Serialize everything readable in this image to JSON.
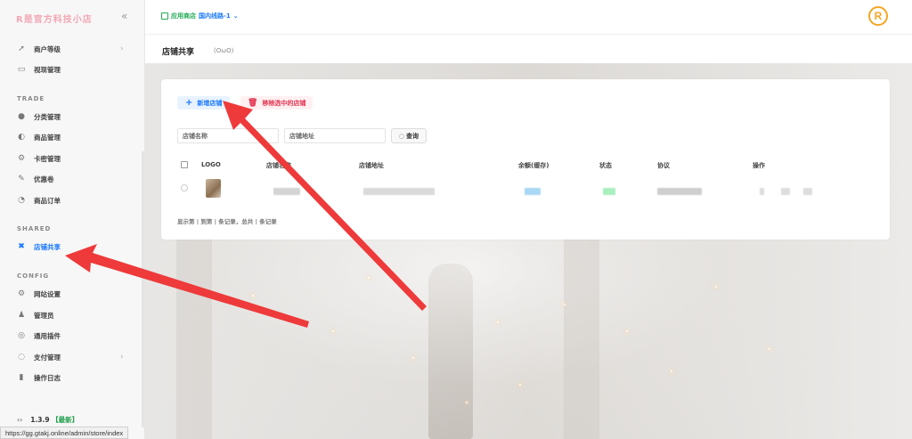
{
  "sidebar": {
    "brand": "R是官方科技小店",
    "items_top": [
      {
        "label": "商户等级",
        "icon": "rocket-icon"
      },
      {
        "label": "视现管理",
        "icon": "list-icon"
      }
    ],
    "sections": [
      {
        "label": "TRADE",
        "items": [
          {
            "label": "分类管理",
            "icon": "folder-icon"
          },
          {
            "label": "商品管理",
            "icon": "box-icon"
          },
          {
            "label": "卡密管理",
            "icon": "key-icon"
          },
          {
            "label": "优惠卷",
            "icon": "ticket-icon"
          },
          {
            "label": "商品订单",
            "icon": "order-icon"
          }
        ]
      },
      {
        "label": "SHARED",
        "items": [
          {
            "label": "店铺共享",
            "icon": "share-icon",
            "active": true
          }
        ]
      },
      {
        "label": "CONFIG",
        "items": [
          {
            "label": "网站设置",
            "icon": "settings-icon"
          },
          {
            "label": "管理员",
            "icon": "admin-icon"
          },
          {
            "label": "通用插件",
            "icon": "plugin-icon"
          },
          {
            "label": "支付管理",
            "icon": "payment-icon"
          },
          {
            "label": "操作日志",
            "icon": "log-icon"
          }
        ]
      }
    ],
    "version": "1.3.9",
    "version_tag": "【最新】"
  },
  "statusbar": {
    "url": "https://gg.gtakj.online/admin/store/index"
  },
  "topbar": {
    "store_label": "应用商店",
    "line_label": "国内线路-1",
    "logo_letter": "R"
  },
  "page": {
    "title": "店铺共享",
    "subtitle": "(OωO)"
  },
  "toolbar": {
    "add_label": "新增店铺",
    "delete_label": "移除选中的店铺"
  },
  "search": {
    "name_placeholder": "店铺名称",
    "address_placeholder": "店铺地址",
    "button_label": "查询"
  },
  "table": {
    "columns": [
      "LOGO",
      "店铺名称",
      "店铺地址",
      "余额(缓存)",
      "状态",
      "协议",
      "操作"
    ]
  },
  "pagination": {
    "text": "显示第 | 到第 | 条记录，总共 | 条记录"
  },
  "colors": {
    "primary": "#1677ff",
    "danger": "#e5324f",
    "success": "#22aa55",
    "brand": "#f2a7b4",
    "accent": "#f5a623",
    "annotation": "#ee3a3a"
  }
}
